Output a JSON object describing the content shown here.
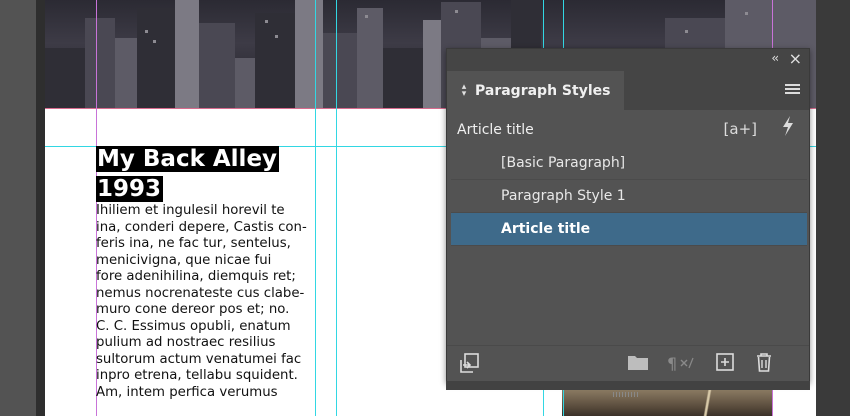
{
  "article": {
    "headline_line1": "My Back Alley",
    "headline_line2": "1993",
    "body": "Ihiliem et ingulesil horevil te\nina, conderi depere, Castis con-\nferis ina, ne fac tur, sentelus,\nmenicivigna, que nicae fui\nfore adenihilina, diemquis ret;\nnemus nocrenateste cus clabe-\nmuro cone dereor pos et; no.\nC. C. Essimus opubli, enatum\npulium ad nostraec resilius\nsultorum actum venatumei fac\ninpro etrena, tellabu squident.\nAm, intem perfica verumus"
  },
  "panel": {
    "tab_label": "Paragraph Styles",
    "current_style": "Article title",
    "new_override_label": "[a+]",
    "styles": [
      {
        "label": "[Basic Paragraph]",
        "selected": false
      },
      {
        "label": "Paragraph Style 1",
        "selected": false
      },
      {
        "label": "Article title",
        "selected": true
      }
    ],
    "icons": {
      "collapse": "double-chevron-left-icon",
      "close": "close-icon",
      "menu": "hamburger-menu-icon",
      "quick_apply": "lightning-bolt-icon",
      "load_styles": "load-styles-icon",
      "folder": "folder-icon",
      "clear_overrides": "pilcrow-clear-icon",
      "new_style": "new-style-icon",
      "delete": "trash-icon"
    }
  },
  "colors": {
    "selection": "#3e6a8a",
    "guide_cyan": "#32d7e3",
    "guide_magenta": "#c873d8",
    "panel_bg": "#535353"
  }
}
